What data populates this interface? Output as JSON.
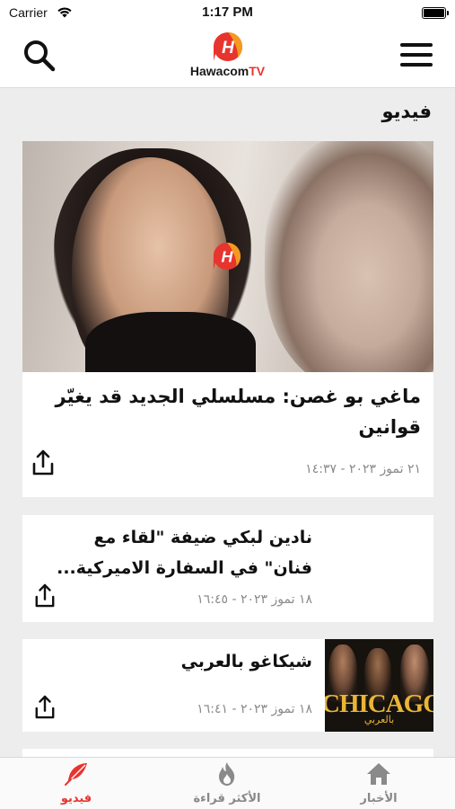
{
  "status_bar": {
    "carrier": "Carrier",
    "time": "1:17 PM"
  },
  "header": {
    "logo_text": "Hawacom",
    "logo_suffix": "TV"
  },
  "section": {
    "title": "فيديو"
  },
  "articles": [
    {
      "title": "ماغي بو غصن: مسلسلي الجديد قد يغيّر قوانين",
      "meta": "٢١ تموز ٢٠٢٣ - ١٤:٣٧"
    },
    {
      "title": "نادين لبكي ضيفة \"لقاء مع فنان\" في السفارة الاميركية...",
      "meta": "١٨ تموز ٢٠٢٣ - ١٦:٤٥"
    },
    {
      "title": "شيكاغو بالعربي",
      "meta": "١٨ تموز ٢٠٢٣ - ١٦:٤١",
      "thumb_text": "CHICAGO",
      "thumb_sub": "بالعربي"
    }
  ],
  "tabs": [
    {
      "label": "فيديو",
      "icon": "feather-icon",
      "active": true
    },
    {
      "label": "الأكثر قراءة",
      "icon": "flame-icon",
      "active": false
    },
    {
      "label": "الأخبار",
      "icon": "home-icon",
      "active": false
    }
  ],
  "colors": {
    "brand_red": "#e8342e",
    "meta_gray": "#8a8a8a",
    "background": "#ededed"
  }
}
